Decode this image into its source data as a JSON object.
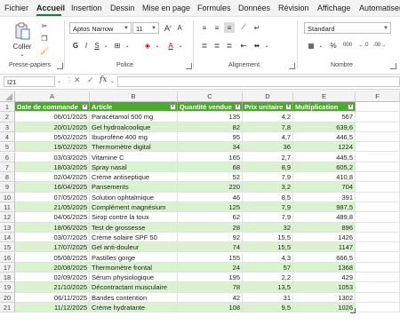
{
  "menu": {
    "items": [
      "Fichier",
      "Accueil",
      "Insertion",
      "Dessin",
      "Mise en page",
      "Formules",
      "Données",
      "Révision",
      "Affichage",
      "Automatiser"
    ],
    "active": "Accueil"
  },
  "ribbon": {
    "clipboard": {
      "paste_label": "Coller",
      "group_label": "Presse-papiers"
    },
    "font": {
      "font_name": "Aptos Narrow",
      "font_size": "11",
      "bold": "G",
      "italic": "I",
      "underline": "S",
      "group_label": "Police"
    },
    "alignment": {
      "group_label": "Alignement"
    },
    "number": {
      "format": "Standard",
      "group_label": "Nombre"
    }
  },
  "formula_bar": {
    "name_box": "I21",
    "fx": "fx",
    "content": ""
  },
  "columns": [
    "A",
    "B",
    "C",
    "D",
    "E",
    "F"
  ],
  "table": {
    "headers": [
      "Date de commande",
      "Article",
      "Quantité vendue",
      "Prix unitaire",
      "Multiplication"
    ],
    "rows": [
      [
        "06/01/2025",
        "Paracétamol 500 mg",
        "135",
        "4,2",
        "567"
      ],
      [
        "20/01/2025",
        "Gel hydroalcoolique",
        "82",
        "7,8",
        "639,6"
      ],
      [
        "05/02/2025",
        "Ibuprofène 400 mg",
        "95",
        "4,7",
        "446,5"
      ],
      [
        "19/02/2025",
        "Thermomètre digital",
        "34",
        "36",
        "1224"
      ],
      [
        "03/03/2025",
        "Vitamine C",
        "165",
        "2,7",
        "445,5"
      ],
      [
        "18/03/2025",
        "Spray nasal",
        "68",
        "8,9",
        "605,2"
      ],
      [
        "02/04/2025",
        "Crème antiseptique",
        "52",
        "7,9",
        "410,8"
      ],
      [
        "16/04/2025",
        "Pansements",
        "220",
        "3,2",
        "704"
      ],
      [
        "07/05/2025",
        "Solution ophtalmique",
        "46",
        "8,5",
        "391"
      ],
      [
        "21/05/2025",
        "Complément magnésium",
        "125",
        "7,9",
        "987,5"
      ],
      [
        "04/06/2025",
        "Sirop contre la toux",
        "62",
        "7,9",
        "489,8"
      ],
      [
        "18/06/2025",
        "Test de grossesse",
        "28",
        "32",
        "896"
      ],
      [
        "03/07/2025",
        "Crème solaire SPF 50",
        "92",
        "15,5",
        "1426"
      ],
      [
        "17/07/2025",
        "Gel anti-douleur",
        "74",
        "15,5",
        "1147"
      ],
      [
        "05/08/2025",
        "Pastilles gorge",
        "155",
        "4,3",
        "666,5"
      ],
      [
        "20/08/2025",
        "Thermomètre frontal",
        "24",
        "57",
        "1368"
      ],
      [
        "02/09/2025",
        "Sérum physiologique",
        "195",
        "2,2",
        "429"
      ],
      [
        "21/10/2025",
        "Décontractant musculaire",
        "78",
        "13,5",
        "1053"
      ],
      [
        "06/11/2025",
        "Bandes contention",
        "42",
        "31",
        "1302"
      ],
      [
        "11/12/2025",
        "Crème hydratante",
        "108",
        "9,5",
        "1026"
      ]
    ]
  },
  "colors": {
    "header_green": "#4ea72e",
    "band_green": "#d9f2d0",
    "accent": "#107c41"
  }
}
